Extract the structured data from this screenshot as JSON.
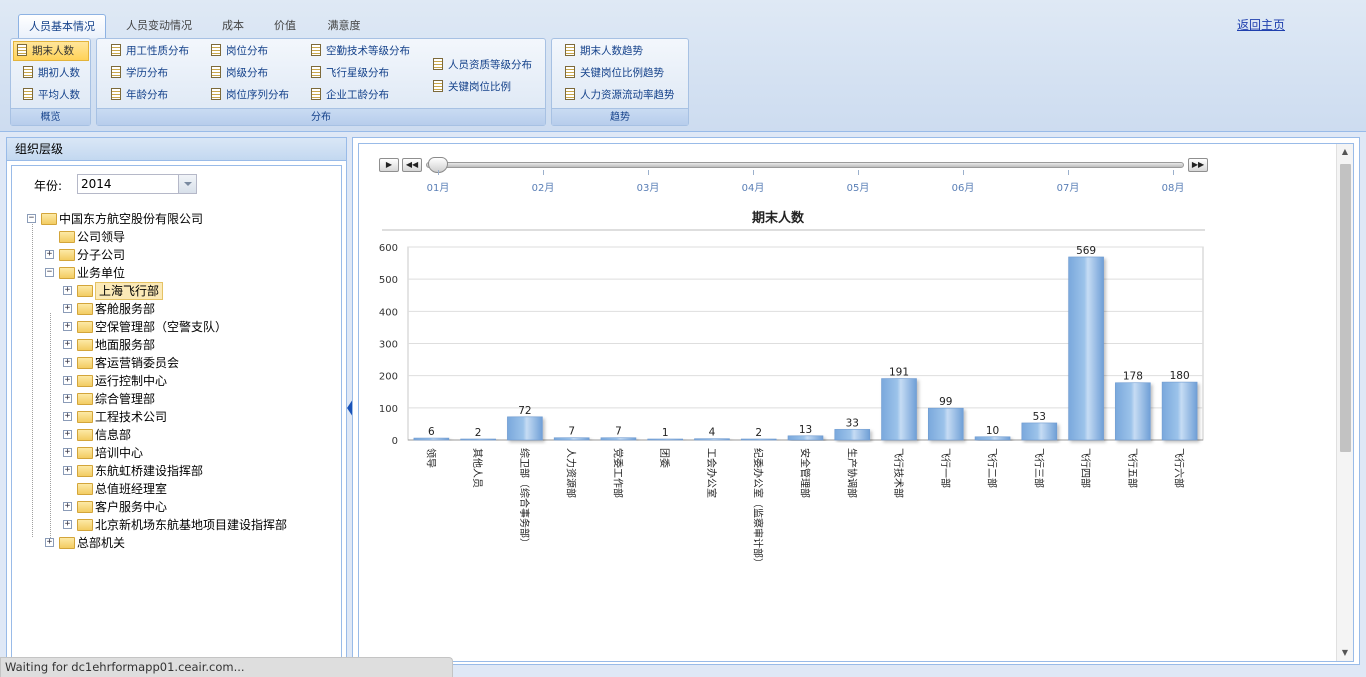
{
  "ribbon": {
    "tabs": [
      {
        "label": "人员基本情况",
        "active": true
      },
      {
        "label": "人员变动情况",
        "active": false
      },
      {
        "label": "成本",
        "active": false
      },
      {
        "label": "价值",
        "active": false
      },
      {
        "label": "满意度",
        "active": false
      }
    ],
    "home_link": "返回主页",
    "groups": {
      "overview": {
        "title": "概览",
        "buttons": [
          "期末人数",
          "期初人数",
          "平均人数"
        ],
        "selected": "期末人数"
      },
      "distribution": {
        "title": "分布",
        "buttons": [
          "用工性质分布",
          "学历分布",
          "年龄分布",
          "岗位分布",
          "岗级分布",
          "岗位序列分布",
          "空勤技术等级分布",
          "飞行星级分布",
          "企业工龄分布",
          "人员资质等级分布",
          "关键岗位比例"
        ]
      },
      "trend": {
        "title": "趋势",
        "buttons": [
          "期末人数趋势",
          "关键岗位比例趋势",
          "人力资源流动率趋势"
        ]
      }
    }
  },
  "left_panel": {
    "title": "组织层级",
    "year_label": "年份:",
    "year_value": "2014",
    "tree": [
      {
        "label": "中国东方航空股份有限公司",
        "expander": "⊟"
      },
      {
        "label": "公司领导",
        "expander": ""
      },
      {
        "label": "分子公司",
        "expander": "+"
      },
      {
        "label": "业务单位",
        "expander": "−"
      },
      {
        "label": "上海飞行部",
        "expander": "+",
        "selected": true
      },
      {
        "label": "客舱服务部",
        "expander": "+"
      },
      {
        "label": "空保管理部（空警支队）",
        "expander": "+"
      },
      {
        "label": "地面服务部",
        "expander": "+"
      },
      {
        "label": "客运营销委员会",
        "expander": "+"
      },
      {
        "label": "运行控制中心",
        "expander": "+"
      },
      {
        "label": "综合管理部",
        "expander": "+"
      },
      {
        "label": "工程技术公司",
        "expander": "+"
      },
      {
        "label": "信息部",
        "expander": "+"
      },
      {
        "label": "培训中心",
        "expander": "+"
      },
      {
        "label": "东航虹桥建设指挥部",
        "expander": "+"
      },
      {
        "label": "总值班经理室",
        "expander": ""
      },
      {
        "label": "客户服务中心",
        "expander": "+"
      },
      {
        "label": "北京新机场东航基地项目建设指挥部",
        "expander": "+"
      },
      {
        "label": "总部机关",
        "expander": "+"
      }
    ]
  },
  "timeline": {
    "months": [
      "01月",
      "02月",
      "03月",
      "04月",
      "05月",
      "06月",
      "07月",
      "08月"
    ],
    "current": "01月"
  },
  "chart_data": {
    "type": "bar",
    "title": "期末人数",
    "categories": [
      "领导",
      "其他人员",
      "综卫部（综合事务部）",
      "人力资源部",
      "党委工作部",
      "团委",
      "工会办公室",
      "纪委办公室（监察审计部）",
      "安全管理部",
      "生产协调部",
      "飞行技术部",
      "飞行一部",
      "飞行二部",
      "飞行三部",
      "飞行四部",
      "飞行五部",
      "飞行六部"
    ],
    "values": [
      6,
      2,
      72,
      7,
      7,
      1,
      4,
      2,
      13,
      33,
      191,
      99,
      10,
      53,
      569,
      178,
      180
    ],
    "ylim": [
      0,
      600
    ],
    "yticks": [
      0,
      100,
      200,
      300,
      400,
      500,
      600
    ],
    "grid": true,
    "bar_color": "#9cc3ea"
  },
  "status": {
    "text": "Waiting for dc1ehrformapp01.ceair.com..."
  }
}
